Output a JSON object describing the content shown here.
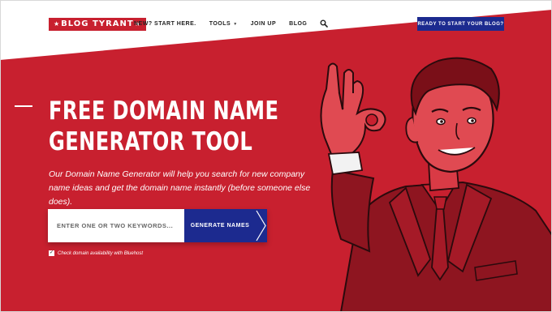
{
  "logo": {
    "text": "BLOG TYRANT",
    "star": "★"
  },
  "nav": {
    "items": [
      {
        "label": "NEW? START HERE."
      },
      {
        "label": "TOOLS",
        "has_dropdown": true
      },
      {
        "label": "JOIN UP"
      },
      {
        "label": "BLOG"
      }
    ],
    "search_icon": "search-icon",
    "cta_label": "READY TO START YOUR BLOG?"
  },
  "hero": {
    "title_line1": "FREE DOMAIN NAME",
    "title_line2": "GENERATOR TOOL",
    "subtitle": "Our Domain Name Generator will help you search for new company name ideas and get the domain name instantly (before someone else does)."
  },
  "form": {
    "placeholder": "ENTER ONE OR TWO KEYWORDS...",
    "value": "",
    "button_label": "GENERATE NAMES",
    "checkbox_checked": true,
    "checkbox_mark": "✓",
    "checkbox_label": "Check domain availability with Bluehost"
  },
  "colors": {
    "brand_red": "#c8202f",
    "accent_navy": "#1c2a8f",
    "white": "#ffffff"
  }
}
